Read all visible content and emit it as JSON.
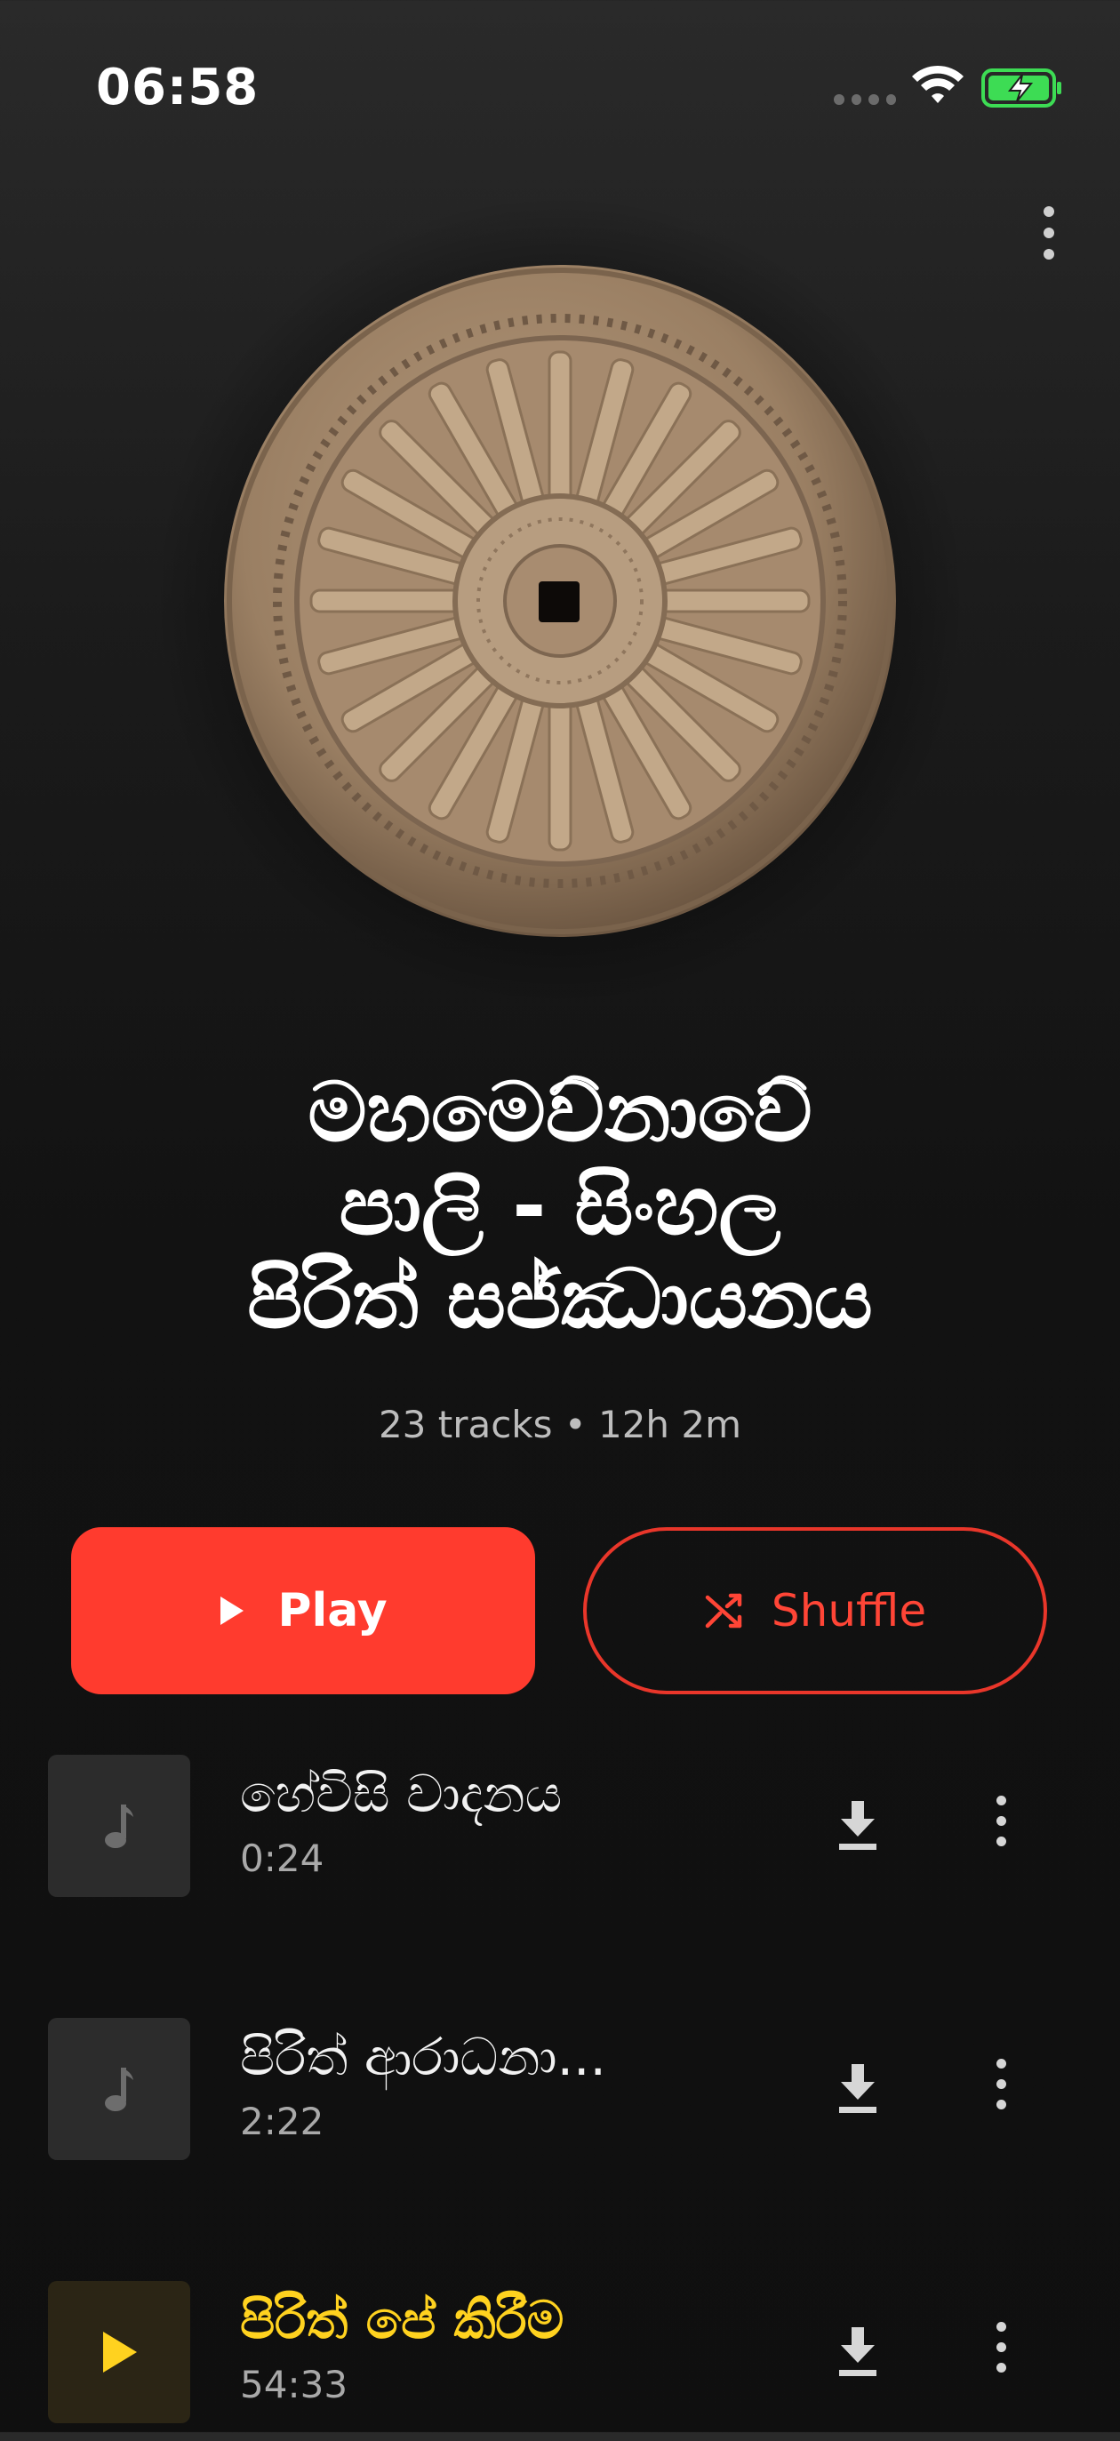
{
  "status_bar": {
    "time": "06:58",
    "icons": [
      "cellular-signal-icon",
      "wifi-icon",
      "battery-charging-icon"
    ]
  },
  "header": {
    "menu_icon": "more-vertical-icon"
  },
  "album": {
    "art": "dharma-wheel-image",
    "title_lines": [
      "මහමෙව්නාවේ",
      "පාලි - සිංහල",
      "පිරිත් සජ්ඣායනය"
    ],
    "meta": "23 tracks • 12h 2m"
  },
  "actions": {
    "play_label": "Play",
    "shuffle_label": "Shuffle",
    "play_color": "#ff3b2e",
    "shuffle_color": "#ff4536"
  },
  "tracks": [
    {
      "title": "හේවිසි වාදනය",
      "duration": "0:24",
      "icon": "music-note-icon",
      "active": false
    },
    {
      "title": "පිරිත් ආරාධනා...",
      "duration": "2:22",
      "icon": "music-note-icon",
      "active": false
    },
    {
      "title": "පිරිත් පේ කිරීම",
      "duration": "54:33",
      "icon": "play-icon",
      "active": true
    }
  ],
  "colors": {
    "active_track": "#ffd21f",
    "background": "#121212"
  }
}
